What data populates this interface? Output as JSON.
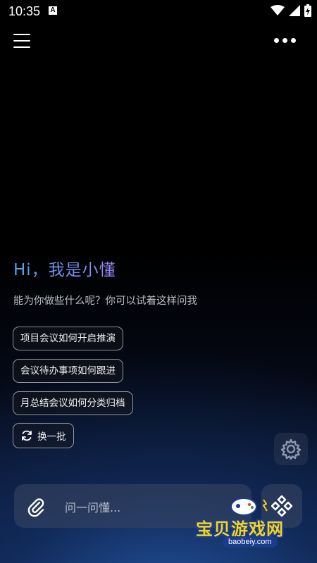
{
  "status_bar": {
    "time": "10:35",
    "notification_icon": "a-badge-icon",
    "icons": [
      "wifi-icon",
      "signal-icon",
      "battery-charging-icon"
    ]
  },
  "header": {
    "menu_icon": "hamburger-menu-icon",
    "more_icon": "more-dots-icon"
  },
  "main": {
    "greeting": "Hi，我是小懂",
    "subtitle": "能为你做些什么呢？你可以试着这样问我",
    "suggestions": [
      {
        "label": "项目会议如何开启推演"
      },
      {
        "label": "会议待办事项如何跟进"
      },
      {
        "label": "月总结会议如何分类归档"
      }
    ],
    "refresh_label": "换一批",
    "settings_icon": "gear-icon"
  },
  "input": {
    "attach_icon": "paperclip-icon",
    "placeholder": "问一问懂...",
    "action_icon": "diamond-grid-icon"
  },
  "watermark": {
    "brand": "宝贝游戏网",
    "url": "baobeiy.com"
  },
  "colors": {
    "greeting_start": "#4fa6e8",
    "greeting_end": "#9a86f2",
    "background_top": "#000000",
    "background_bottom": "#0d2146",
    "watermark_yellow": "#f5d31c",
    "watermark_blue": "#1a3c8c"
  }
}
